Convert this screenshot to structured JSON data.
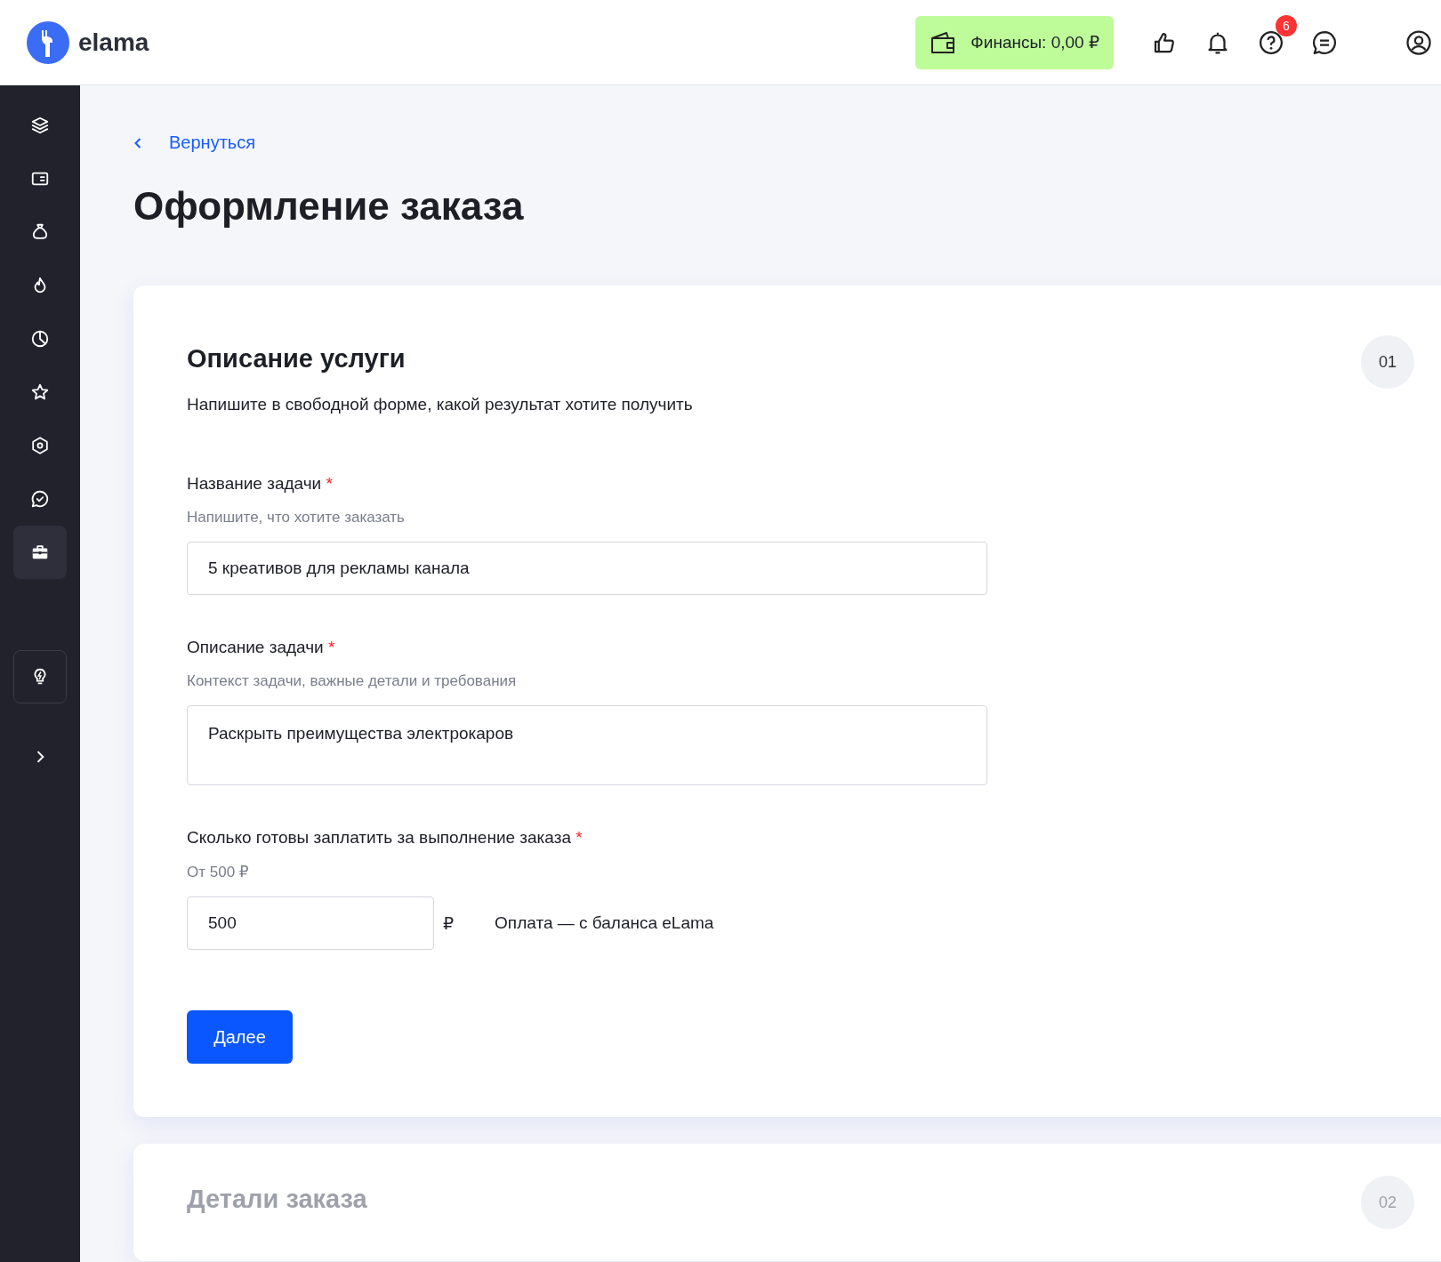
{
  "header": {
    "logo": "elama",
    "finance": "Финансы: 0,00 ₽",
    "help_badge": "6"
  },
  "sidebar": {
    "items": [
      {
        "selected": false
      },
      {
        "selected": false
      },
      {
        "selected": false
      },
      {
        "selected": false
      },
      {
        "selected": false
      },
      {
        "selected": false
      },
      {
        "selected": false
      },
      {
        "selected": false
      },
      {
        "selected": true
      }
    ]
  },
  "back_link": "Вернуться",
  "title": "Оформление заказа",
  "steps": [
    {
      "number": "01",
      "active": true,
      "title": "Описание услуги",
      "subtitle": "Напишите в свободной форме, какой результат хотите получить",
      "fields": [
        {
          "kind": "input",
          "label": "Название задачи",
          "required_mark": "*",
          "hint": "Напишите, что хотите заказать",
          "value": "5 креативов для рекламы канала"
        },
        {
          "kind": "textarea",
          "label": "Описание задачи",
          "required_mark": "*",
          "hint": "Контекст задачи, важные детали и требования",
          "value": "Раскрыть преимущества электрокаров"
        },
        {
          "kind": "price",
          "label": "Сколько готовы заплатить за выполнение заказа",
          "required_mark": "*",
          "hint": "От 500 ₽",
          "value": "500",
          "currency": "₽",
          "note": "Оплата — с баланса eLama"
        }
      ],
      "button": "Далее"
    },
    {
      "number": "02",
      "active": false,
      "title": "Детали заказа"
    }
  ]
}
